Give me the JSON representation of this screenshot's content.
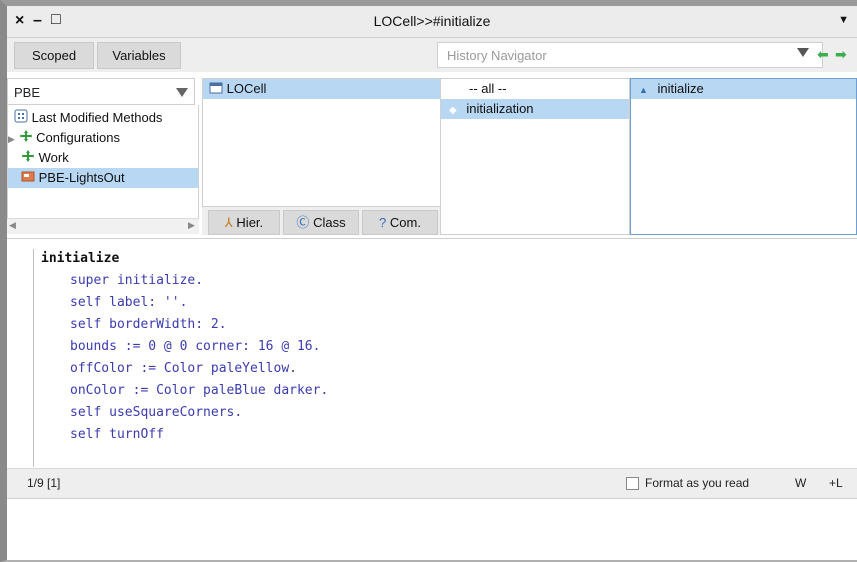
{
  "window": {
    "title": "LOCell>>#initialize",
    "close_glyph": "×",
    "minimize_glyph": "–",
    "maximize_glyph": "□"
  },
  "toolbar": {
    "scoped_label": "Scoped",
    "variables_label": "Variables",
    "history_placeholder": "History Navigator"
  },
  "packages": {
    "selected_package": "PBE",
    "items": [
      {
        "label": "Last Modified Methods",
        "icon": "grid-icon"
      },
      {
        "label": "Configurations",
        "icon": "config-icon"
      },
      {
        "label": "Work",
        "icon": "config-icon"
      },
      {
        "label": "PBE-LightsOut",
        "icon": "package-icon"
      }
    ]
  },
  "classes": {
    "items": [
      "LOCell"
    ]
  },
  "class_tabs": {
    "hier_label": "Hier.",
    "class_label": "Class",
    "com_label": "Com."
  },
  "protocols": {
    "items": [
      "-- all --",
      "initialization"
    ]
  },
  "methods": {
    "items": [
      "initialize"
    ]
  },
  "code": {
    "lines": [
      "initialize",
      "super initialize.",
      "self label: ''.",
      "self borderWidth: 2.",
      "bounds := 0 @ 0 corner: 16 @ 16.",
      "offColor := Color paleYellow.",
      "onColor := Color paleBlue darker.",
      "self useSquareCorners.",
      "self turnOff"
    ]
  },
  "status": {
    "position": "1/9 [1]",
    "format_label": "Format as you read",
    "w_label": "W",
    "l_label": "+L"
  },
  "colors": {
    "selection": "#b7d7f2",
    "keyword": "#3b3bb0",
    "literal": "#c13b3b",
    "nav_arrow": "#3cae50"
  }
}
